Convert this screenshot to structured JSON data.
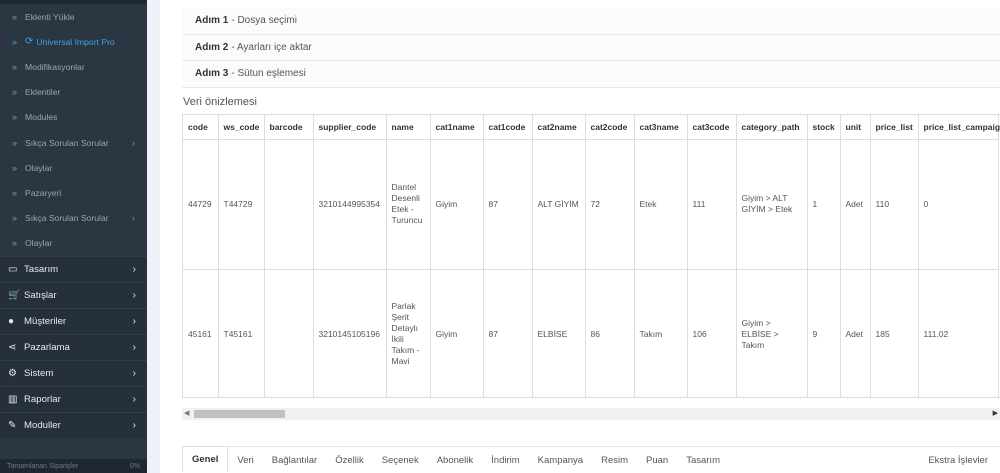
{
  "sidebar": {
    "sub_items": [
      {
        "label": "Eklenti Yükle"
      },
      {
        "label": "Universal Import Pro",
        "active": true,
        "icon": "sync-icon"
      },
      {
        "label": "Modifikasyonlar"
      },
      {
        "label": "Eklentiler"
      },
      {
        "label": "Modules"
      },
      {
        "label": "Sıkça Sorulan Sorular",
        "has_children": true
      },
      {
        "label": "Olaylar"
      },
      {
        "label": "Pazaryeri"
      },
      {
        "label": "Sıkça Sorulan Sorular",
        "has_children": true
      },
      {
        "label": "Olaylar"
      }
    ],
    "main_items": [
      {
        "label": "Tasarım",
        "icon": "monitor-icon"
      },
      {
        "label": "Satışlar",
        "icon": "cart-icon"
      },
      {
        "label": "Müşteriler",
        "icon": "user-icon"
      },
      {
        "label": "Pazarlama",
        "icon": "share-icon"
      },
      {
        "label": "Sistem",
        "icon": "gear-icon"
      },
      {
        "label": "Raporlar",
        "icon": "bar-chart-icon"
      },
      {
        "label": "Moduller",
        "icon": "wrench-icon"
      }
    ],
    "bottom": {
      "label": "Tamamlanan Siparişler",
      "value": "0%"
    }
  },
  "steps": [
    {
      "num": "Adım 1",
      "text": " - Dosya seçimi"
    },
    {
      "num": "Adım 2",
      "text": " - Ayarları içe aktar"
    },
    {
      "num": "Adım 3",
      "text": " - Sütun eşlemesi"
    }
  ],
  "preview_title": "Veri önizlemesi",
  "table": {
    "columns": [
      "code",
      "ws_code",
      "barcode",
      "supplier_code",
      "name",
      "cat1name",
      "cat1code",
      "cat2name",
      "cat2code",
      "cat3name",
      "cat3code",
      "category_path",
      "stock",
      "unit",
      "price_list",
      "price_list_campaign"
    ],
    "rows": [
      [
        "44729",
        "T44729",
        "",
        "3210144995354",
        "Dantel Desenli Etek - Turuncu",
        "Giyim",
        "87",
        "ALT GİYİM",
        "72",
        "Etek",
        "111",
        "Giyim > ALT GİYİM > Etek",
        "1",
        "Adet",
        "110",
        "0"
      ],
      [
        "45161",
        "T45161",
        "",
        "3210145105196",
        "Parlak Şerit Detaylı İkili Takım - Mavi",
        "Giyim",
        "87",
        "ELBİSE",
        "86",
        "Takım",
        "106",
        "Giyim > ELBİSE > Takım",
        "9",
        "Adet",
        "185",
        "111.02"
      ]
    ]
  },
  "scroll_arrows": {
    "left": "◀",
    "right": "▶"
  },
  "tabs": [
    "Genel",
    "Veri",
    "Bağlantılar",
    "Özellik",
    "Seçenek",
    "Abonelik",
    "İndirim",
    "Kampanya",
    "Resim",
    "Puan",
    "Tasarım"
  ],
  "tabs_active": "Genel",
  "tabs_extra": "Ekstra İşlevler"
}
